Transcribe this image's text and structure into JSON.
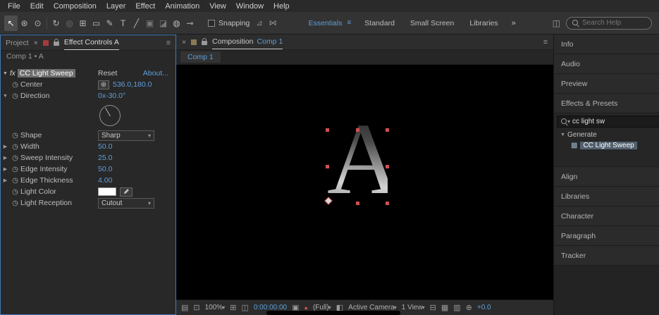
{
  "icons": {
    "menu": "≡",
    "close": "×",
    "caret_down": "▾",
    "tri_down": "▼",
    "tri_right": "▶",
    "stopwatch": "◷",
    "position_xhair": "⊕",
    "chevron_overflow": "»",
    "search_clear": "x",
    "snap_a": "⊿",
    "snap_b": "⋈"
  },
  "menubar": {
    "items": [
      "File",
      "Edit",
      "Composition",
      "Layer",
      "Effect",
      "Animation",
      "View",
      "Window",
      "Help"
    ]
  },
  "toolbar": {
    "tools": [
      {
        "name": "selection-tool",
        "glyph": "↖"
      },
      {
        "name": "hand-tool",
        "glyph": "⊛"
      },
      {
        "name": "zoom-tool",
        "glyph": "⊙"
      },
      {
        "name": "rotate-tool",
        "glyph": "↻"
      },
      {
        "name": "camera-tool",
        "glyph": "◎"
      },
      {
        "name": "pan-behind-tool",
        "glyph": "⊞"
      },
      {
        "name": "shape-tool",
        "glyph": "▭"
      },
      {
        "name": "pen-tool",
        "glyph": "✎"
      },
      {
        "name": "type-tool",
        "glyph": "T"
      },
      {
        "name": "brush-tool",
        "glyph": "╱"
      },
      {
        "name": "clone-stamp-tool",
        "glyph": "▣"
      },
      {
        "name": "eraser-tool",
        "glyph": "◪"
      },
      {
        "name": "roto-brush-tool",
        "glyph": "◍"
      },
      {
        "name": "puppet-pin-tool",
        "glyph": "⊸"
      }
    ],
    "snapping_label": "Snapping",
    "workspaces": [
      "Essentials",
      "Standard",
      "Small Screen",
      "Libraries"
    ],
    "search_placeholder": "Search Help"
  },
  "left_panel": {
    "tabs": [
      {
        "label": "Project"
      },
      {
        "label": "Effect Controls A"
      }
    ],
    "comp_label": "Comp 1 • A",
    "effect": {
      "fx_badge": "fx",
      "name": "CC Light Sweep",
      "reset_label": "Reset",
      "about_label": "About...",
      "properties": [
        {
          "label": "Center",
          "value": "536.0,180.0"
        },
        {
          "label": "Direction",
          "value": "0x-30.0°"
        },
        {
          "label": "Shape",
          "value": "Sharp"
        },
        {
          "label": "Width",
          "value": "50.0"
        },
        {
          "label": "Sweep Intensity",
          "value": "25.0"
        },
        {
          "label": "Edge Intensity",
          "value": "50.0"
        },
        {
          "label": "Edge Thickness",
          "value": "4.00"
        },
        {
          "label": "Light Color",
          "value": ""
        },
        {
          "label": "Light Reception",
          "value": "Cutout"
        }
      ]
    }
  },
  "composition": {
    "tab_title": "Composition",
    "tab_comp_name": "Comp 1",
    "subtab_label": "Comp 1",
    "canvas_letter": "A",
    "statusbar": {
      "zoom": "100%",
      "timecode": "0:00:00:00",
      "resolution": "(Full)",
      "camera": "Active Camera",
      "views": "1 View",
      "exposure": "+0.0"
    },
    "sb_icons": {
      "a": "▤",
      "b": "⊡",
      "c": "⊞",
      "d": "◫",
      "cam": "▣",
      "dot": "●",
      "e": "◧",
      "f": "⊟",
      "g": "▦",
      "h": "▥",
      "i": "⊕"
    }
  },
  "right_panel": {
    "sections_top": [
      "Info",
      "Audio",
      "Preview"
    ],
    "effects_presets": {
      "title": "Effects & Presets",
      "search_value": "cc light sw",
      "group_label": "Generate",
      "item": "CC Light Sweep",
      "item_icon": "▩",
      "foot_icon": "⊡"
    },
    "sections_bottom": [
      "Align",
      "Libraries",
      "Character",
      "Paragraph",
      "Tracker"
    ]
  }
}
